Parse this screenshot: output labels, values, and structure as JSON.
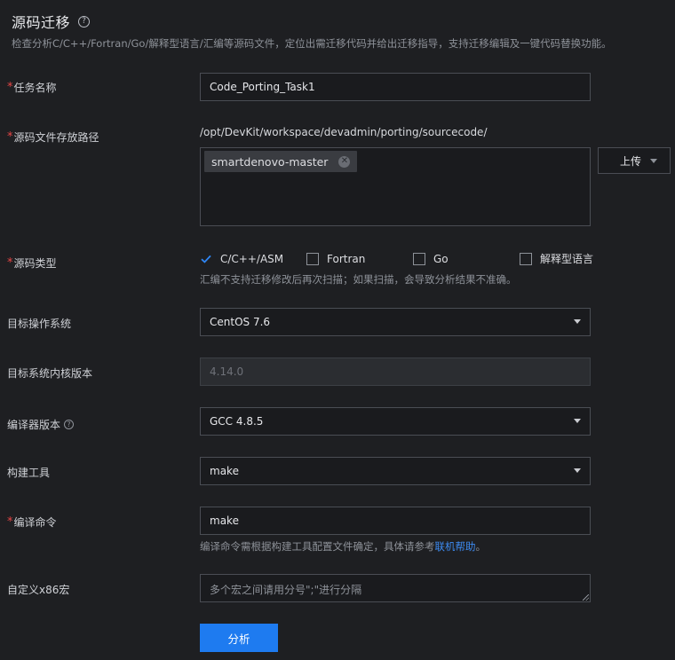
{
  "header": {
    "title": "源码迁移",
    "subtitle": "检查分析C/C++/Fortran/Go/解释型语言/汇编等源码文件，定位出需迁移代码并给出迁移指导，支持迁移编辑及一键代码替换功能。"
  },
  "form": {
    "task_name": {
      "label": "任务名称",
      "value": "Code_Porting_Task1"
    },
    "source_path": {
      "label": "源码文件存放路径",
      "path": "/opt/DevKit/workspace/devadmin/porting/sourcecode/",
      "tag": "smartdenovo-master",
      "upload_label": "上传"
    },
    "source_type": {
      "label": "源码类型",
      "options": [
        {
          "label": "C/C++/ASM",
          "checked": true
        },
        {
          "label": "Fortran",
          "checked": false
        },
        {
          "label": "Go",
          "checked": false
        },
        {
          "label": "解释型语言",
          "checked": false
        }
      ],
      "hint": "汇编不支持迁移修改后再次扫描；如果扫描，会导致分析结果不准确。"
    },
    "target_os": {
      "label": "目标操作系统",
      "value": "CentOS 7.6"
    },
    "kernel_version": {
      "label": "目标系统内核版本",
      "value": "4.14.0"
    },
    "compiler_version": {
      "label": "编译器版本",
      "value": "GCC 4.8.5"
    },
    "build_tool": {
      "label": "构建工具",
      "value": "make"
    },
    "compile_cmd": {
      "label": "编译命令",
      "value": "make",
      "hint_prefix": "编译命令需根据构建工具配置文件确定，具体请参考",
      "hint_link": "联机帮助",
      "hint_suffix": "。"
    },
    "x86_macro": {
      "label": "自定义x86宏",
      "placeholder": "多个宏之间请用分号\";\"进行分隔"
    }
  },
  "actions": {
    "analyze_label": "分析"
  },
  "colors": {
    "accent": "#1e7bf0",
    "required": "#e64545",
    "link": "#3d8bf2",
    "background": "#1e1f22"
  }
}
